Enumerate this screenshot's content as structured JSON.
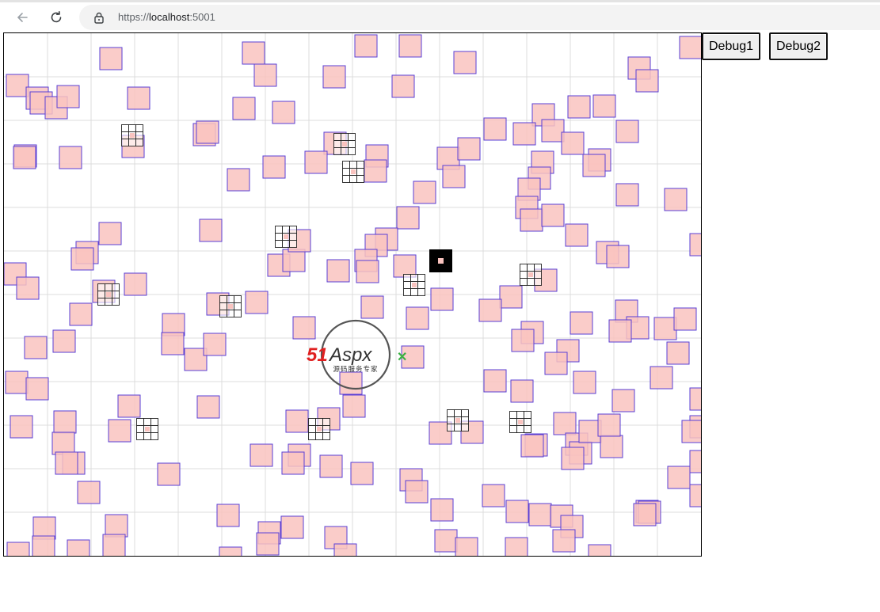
{
  "browser": {
    "url_prefix": "https://",
    "url_host": "localhost",
    "url_port": ":5001",
    "icons": [
      "back-arrow-icon",
      "reload-icon",
      "lock-icon"
    ]
  },
  "toolbar": {
    "debug1_label": "Debug1",
    "debug2_label": "Debug2"
  },
  "logo": {
    "brand_red": "51",
    "brand_black": "Aspx",
    "tagline": "源码服务专家"
  },
  "colors": {
    "box_fill": "#f9c3bf",
    "box_stroke": "#5a3fd6",
    "grid_line": "#dcdcdc",
    "grid_cell_stroke": "#222222",
    "player_fill": "#000000",
    "logo_red": "#e02020",
    "logo_green": "#3cb043"
  }
}
